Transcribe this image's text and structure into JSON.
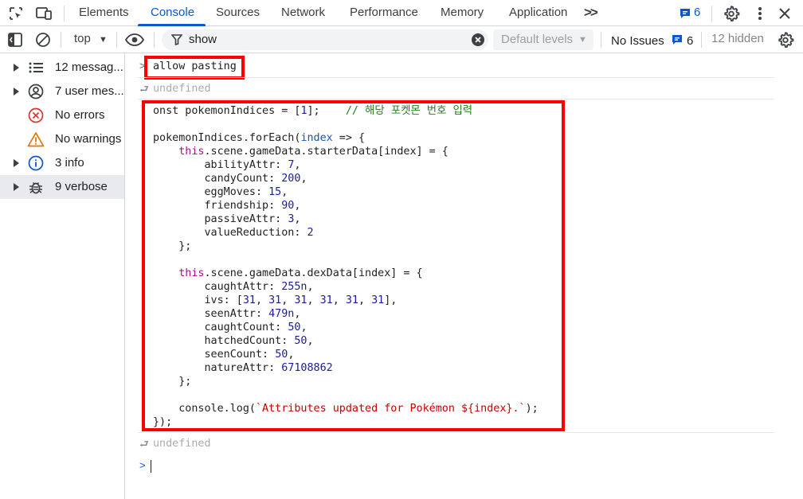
{
  "tabs": {
    "items": [
      "Elements",
      "Console",
      "Sources",
      "Network",
      "Performance",
      "Memory",
      "Application"
    ],
    "active": "Console",
    "overflow": ">>",
    "issues_count": "6"
  },
  "toolbar": {
    "context": "top",
    "filter_value": "show",
    "levels": "Default levels",
    "no_issues": "No Issues",
    "issues_count": "6",
    "hidden": "12 hidden"
  },
  "sidebar": {
    "items": [
      {
        "label": "12 messag...",
        "icon": "list-icon",
        "expandable": true
      },
      {
        "label": "7 user mes...",
        "icon": "user-icon",
        "expandable": true
      },
      {
        "label": "No errors",
        "icon": "error-icon",
        "expandable": false
      },
      {
        "label": "No warnings",
        "icon": "warning-icon",
        "expandable": false
      },
      {
        "label": "3 info",
        "icon": "info-icon",
        "expandable": true
      },
      {
        "label": "9 verbose",
        "icon": "bug-icon",
        "expandable": true
      }
    ]
  },
  "console": {
    "entry1": "allow pasting",
    "result1": "undefined",
    "code_lines": [
      "onst pokemonIndices = [1];    // 해당 포켓몬 번호 입력",
      "",
      "pokemonIndices.forEach(index => {",
      "    this.scene.gameData.starterData[index] = {",
      "        abilityAttr: 7,",
      "        candyCount: 200,",
      "        eggMoves: 15,",
      "        friendship: 90,",
      "        passiveAttr: 3,",
      "        valueReduction: 2",
      "    };",
      "",
      "    this.scene.gameData.dexData[index] = {",
      "        caughtAttr: 255n,",
      "        ivs: [31, 31, 31, 31, 31, 31],",
      "        seenAttr: 479n,",
      "        caughtCount: 50,",
      "        hatchedCount: 50,",
      "        seenCount: 50,",
      "        natureAttr: 67108862",
      "    };",
      "",
      "    console.log(`Attributes updated for Pokémon ${index}.`);",
      "});"
    ],
    "result2": "undefined"
  },
  "colors": {
    "accent": "#0b57d0",
    "highlight_box": "#ff0000",
    "keyword": "#a4128b",
    "number": "#1a1aa6",
    "string": "#c80000",
    "comment": "#237c1c"
  }
}
